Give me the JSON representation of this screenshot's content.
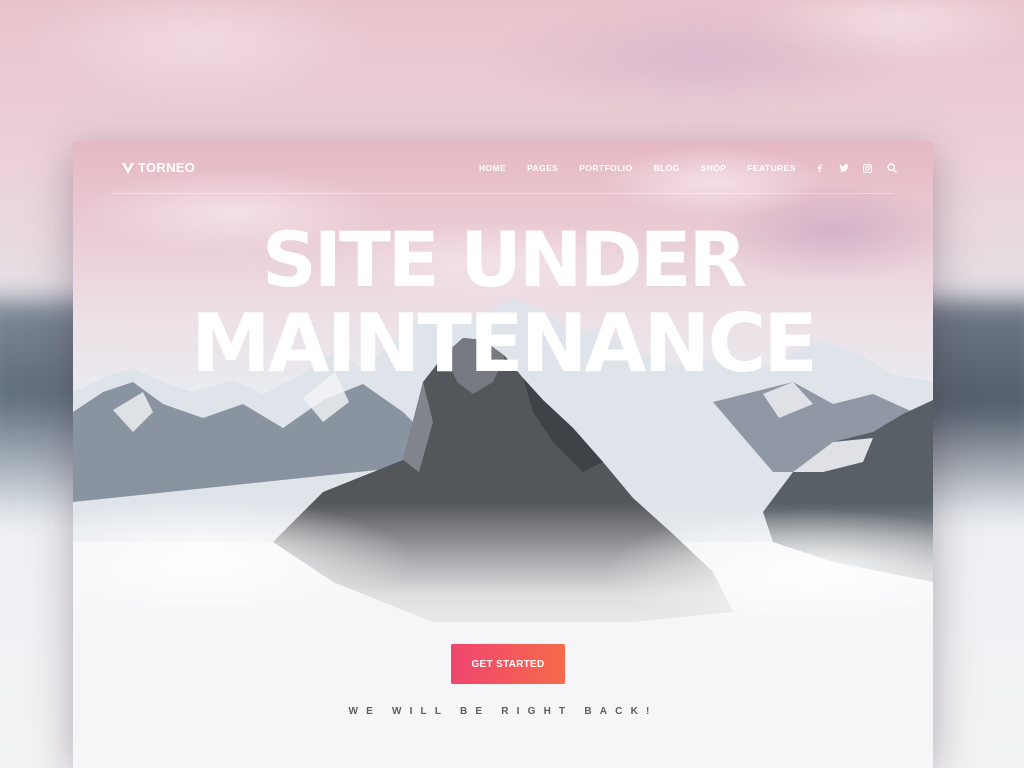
{
  "brand": {
    "name": "TORNEO"
  },
  "nav": {
    "items": [
      {
        "label": "HOME"
      },
      {
        "label": "PAGES"
      },
      {
        "label": "PORTFOLIO"
      },
      {
        "label": "BLOG"
      },
      {
        "label": "SHOP"
      },
      {
        "label": "FEATURES"
      }
    ]
  },
  "social": {
    "icons": [
      "facebook-icon",
      "twitter-icon",
      "instagram-icon",
      "search-icon"
    ]
  },
  "hero": {
    "headline_line1": "SITE UNDER",
    "headline_line2": "MAINTENANCE",
    "cta_label": "GET STARTED",
    "tagline": "WE WILL BE RIGHT BACK!"
  },
  "colors": {
    "cta_start": "#f0456f",
    "cta_end": "#f76a4b",
    "sky_top": "#e6b9c4",
    "text_light": "#ffffff",
    "tagline": "#5d5d63"
  }
}
